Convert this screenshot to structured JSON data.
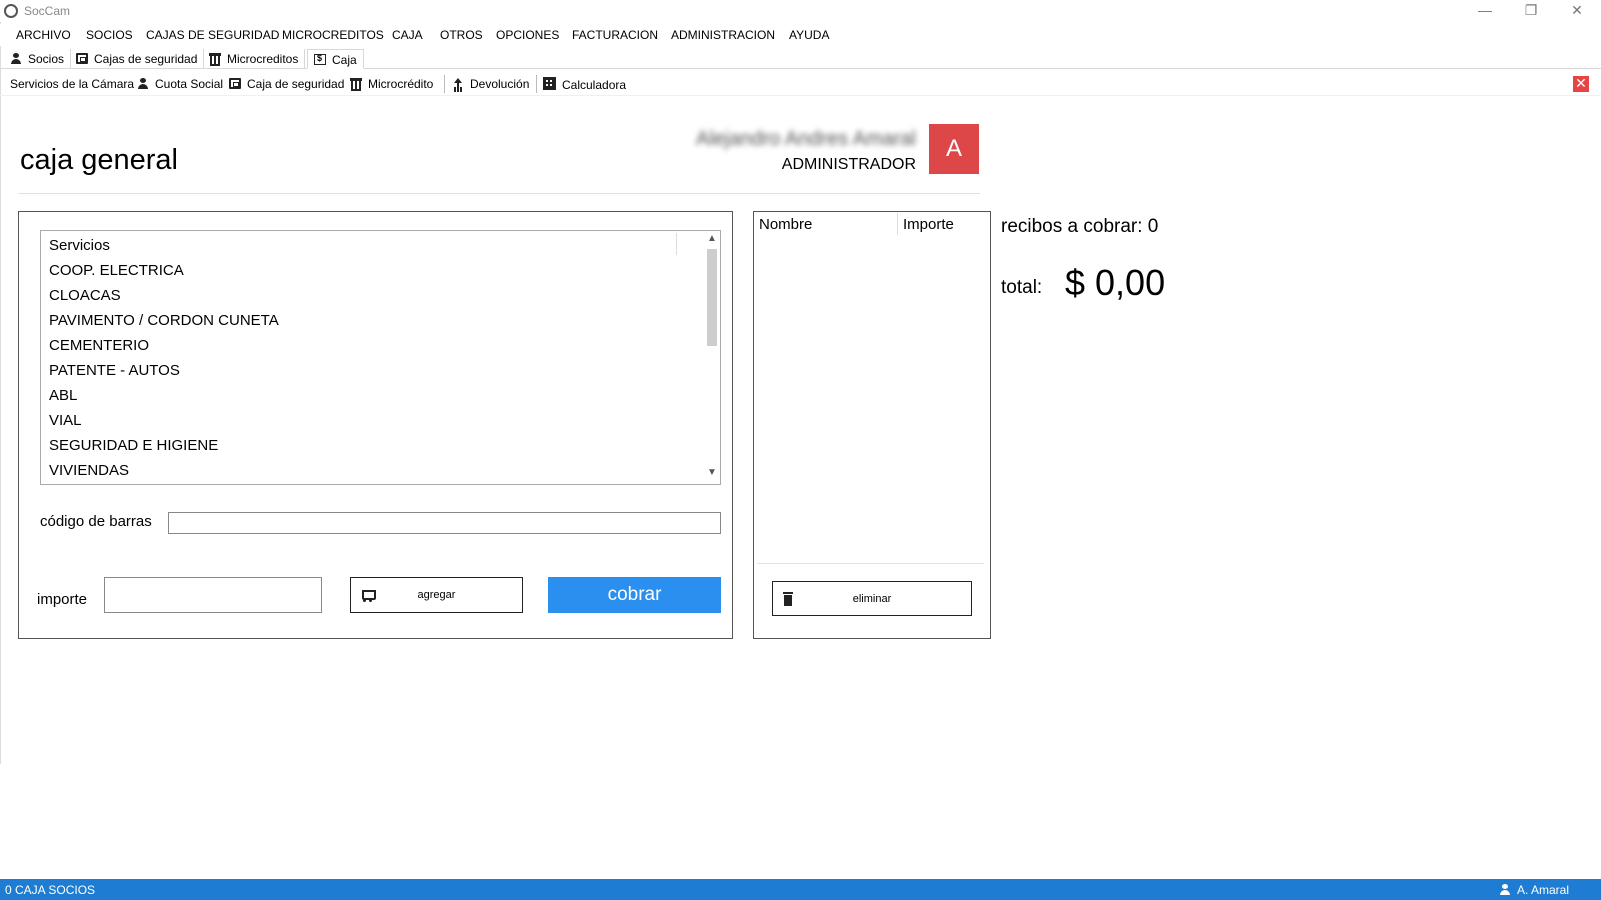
{
  "window": {
    "title": "SocCam",
    "controls": [
      "—",
      "❐",
      "✕"
    ]
  },
  "menu": [
    "ARCHIVO",
    "SOCIOS",
    "CAJAS DE SEGURIDAD",
    "MICROCREDITOS",
    "CAJA",
    "OTROS",
    "OPCIONES",
    "FACTURACION",
    "ADMINISTRACION",
    "AYUDA"
  ],
  "tabs": [
    {
      "label": "Socios",
      "icon": "user-icon"
    },
    {
      "label": "Cajas de seguridad",
      "icon": "safe-icon"
    },
    {
      "label": "Microcreditos",
      "icon": "bank-icon"
    },
    {
      "label": "Caja",
      "icon": "cash-icon",
      "active": true
    }
  ],
  "toolbar": {
    "servicios": "Servicios de la Cámara",
    "cuota": "Cuota Social",
    "caja_seg": "Caja de seguridad",
    "microcredito": "Microcrédito",
    "devolucion": "Devolución",
    "calculadora": "Calculadora",
    "close": "✕"
  },
  "header": {
    "title": "caja general",
    "user_name": "Alejandro Andres Amaral",
    "user_role": "ADMINISTRADOR",
    "avatar_letter": "A",
    "avatar_color": "#dd4747"
  },
  "services": {
    "header": "Servicios",
    "items": [
      "COOP. ELECTRICA",
      "CLOACAS",
      "PAVIMENTO / CORDON CUNETA",
      "CEMENTERIO",
      "PATENTE - AUTOS",
      "ABL",
      "VIAL",
      "SEGURIDAD E HIGIENE",
      "VIVIENDAS"
    ],
    "scroll_up": "▲",
    "scroll_down": "▼"
  },
  "form": {
    "barcode_label": "código de barras",
    "barcode_value": "",
    "importe_label": "importe",
    "importe_value": "",
    "agregar": "agregar",
    "cobrar": "cobrar",
    "cobrar_color": "#2a8fef"
  },
  "receipt": {
    "col_nombre": "Nombre",
    "col_importe": "Importe",
    "eliminar": "eliminar"
  },
  "summary": {
    "receipts_count": "recibos a cobrar: 0",
    "total_label": "total:",
    "total_value": "$ 0,00"
  },
  "status": {
    "left": "0 CAJA SOCIOS",
    "user": "A. Amaral",
    "color": "#1e7dd2"
  }
}
